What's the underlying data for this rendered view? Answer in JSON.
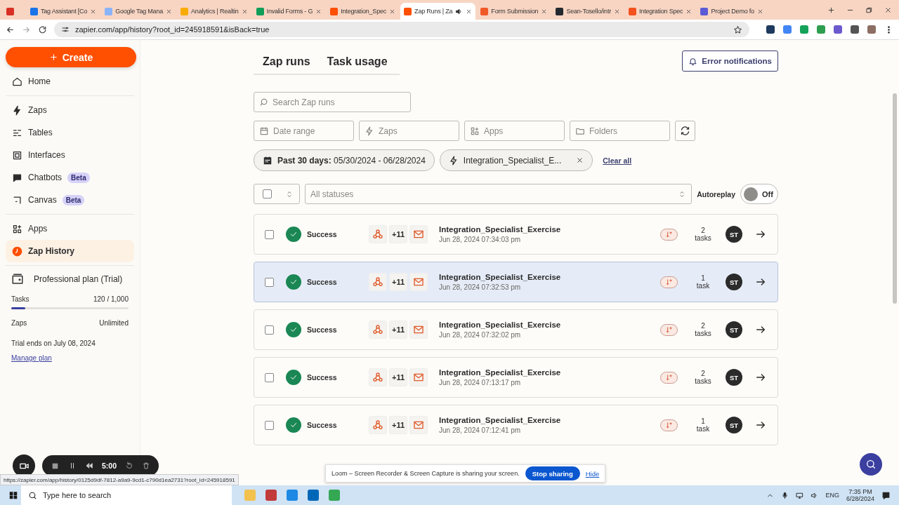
{
  "browser": {
    "tabs": [
      {
        "color": "#d93025",
        "audio": false,
        "selected": false
      },
      {
        "title": "Tag Assistant [Co",
        "color": "#1a73e8",
        "audio": false,
        "selected": false
      },
      {
        "title": "Google Tag Mana",
        "color": "#8ab4f8",
        "audio": false,
        "selected": false
      },
      {
        "title": "Analytics | Realtin",
        "color": "#f9ab00",
        "audio": false,
        "selected": false
      },
      {
        "title": "Invalid Forms - G",
        "color": "#0f9d58",
        "audio": false,
        "selected": false
      },
      {
        "title": "Integration_Spec",
        "color": "#ff4f00",
        "audio": false,
        "selected": false
      },
      {
        "title": "Zap Runs | Za",
        "color": "#ff4f00",
        "audio": true,
        "selected": true
      },
      {
        "title": "Form Submission",
        "color": "#f05a28",
        "audio": false,
        "selected": false
      },
      {
        "title": "Sean-Tosello/intr",
        "color": "#24292f",
        "audio": false,
        "selected": false
      },
      {
        "title": "Integration Spec",
        "color": "#f4511e",
        "audio": false,
        "selected": false
      },
      {
        "title": "Project Demo fo",
        "color": "#5b5bd6",
        "audio": false,
        "selected": false
      }
    ],
    "address": "zapier.com/app/history?root_id=245918591&isBack=true"
  },
  "sidebar": {
    "create": "Create",
    "groups": [
      [
        {
          "label": "Home",
          "selected": false
        }
      ],
      [
        {
          "label": "Zaps",
          "selected": false
        },
        {
          "label": "Tables",
          "selected": false
        },
        {
          "label": "Interfaces",
          "selected": false
        },
        {
          "label": "Chatbots",
          "badge": "Beta",
          "selected": false
        },
        {
          "label": "Canvas",
          "badge": "Beta",
          "selected": false
        }
      ],
      [
        {
          "label": "Apps",
          "selected": false
        },
        {
          "label": "Zap History",
          "selected": true
        }
      ]
    ],
    "plan": {
      "title": "Professional plan (Trial)",
      "tasks_label": "Tasks",
      "tasks_value": "120 / 1,000",
      "level": 0.12,
      "zaps_label": "Zaps",
      "zaps_value": "Unlimited",
      "trial_note": "Trial ends on July 08, 2024",
      "link": "Manage plan"
    }
  },
  "main": {
    "tabs": [
      "Zap runs",
      "Task usage"
    ],
    "error_button": "Error notifications",
    "search": {
      "placeholder": "Search Zap runs"
    },
    "filters": [
      {
        "placeholder": "Date range"
      },
      {
        "placeholder": "Zaps"
      },
      {
        "placeholder": "Apps"
      },
      {
        "placeholder": "Folders"
      }
    ],
    "chips": [
      {
        "kind": "date",
        "text": "**Past 30 days:** 05/30/2024 - 06/28/2024"
      },
      {
        "kind": "zap",
        "text": "Integration_Specialist_E..."
      }
    ],
    "clear_all": "Clear all",
    "status_select": "All statuses",
    "autoreplay": {
      "label": "Autoreplay",
      "on": false,
      "state": "Off"
    },
    "runs": [
      {
        "checked": false,
        "hovered": false,
        "status": "Success",
        "more_apps": "+11",
        "name": "Integration_Specialist_Exercise",
        "date": "Jun 28, 2024 07:34:03 pm",
        "tasks": "2",
        "tasks_unit": "tasks",
        "avatar": "ST"
      },
      {
        "checked": false,
        "hovered": true,
        "status": "Success",
        "more_apps": "+11",
        "name": "Integration_Specialist_Exercise",
        "date": "Jun 28, 2024 07:32:53 pm",
        "tasks": "1",
        "tasks_unit": "task",
        "avatar": "ST"
      },
      {
        "checked": false,
        "hovered": false,
        "status": "Success",
        "more_apps": "+11",
        "name": "Integration_Specialist_Exercise",
        "date": "Jun 28, 2024 07:32:02 pm",
        "tasks": "2",
        "tasks_unit": "tasks",
        "avatar": "ST"
      },
      {
        "checked": false,
        "hovered": false,
        "status": "Success",
        "more_apps": "+11",
        "name": "Integration_Specialist_Exercise",
        "date": "Jun 28, 2024 07:13:17 pm",
        "tasks": "2",
        "tasks_unit": "tasks",
        "avatar": "ST"
      },
      {
        "checked": false,
        "hovered": false,
        "status": "Success",
        "more_apps": "+11",
        "name": "Integration_Specialist_Exercise",
        "date": "Jun 28, 2024 07:12:41 pm",
        "tasks": "1",
        "tasks_unit": "task",
        "avatar": "ST"
      }
    ]
  },
  "recorder": {
    "timer": "5:00",
    "notice": "Loom – Screen Recorder & Screen Capture is sharing your screen.",
    "stop": "Stop sharing",
    "hide": "Hide"
  },
  "status_url": "https://zapier.com/app/history/0125d9df-7812-a9a9-9cd1-c790d1ea2731?root_id=245918591",
  "taskbar": {
    "search": "Type here to search",
    "lang": "ENG",
    "time": "7:35 PM",
    "date": "6/28/2024"
  }
}
